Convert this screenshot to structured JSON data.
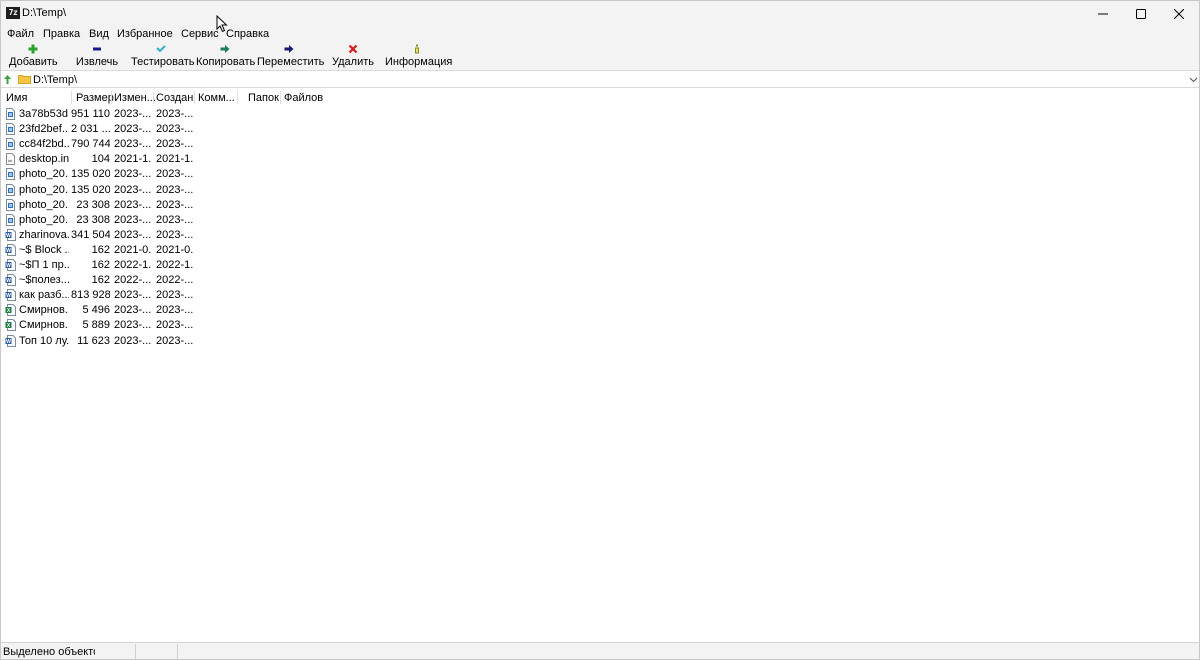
{
  "window": {
    "app_icon_text": "7z",
    "title": "D:\\Temp\\"
  },
  "menu": [
    {
      "label": "Файл"
    },
    {
      "label": "Правка"
    },
    {
      "label": "Вид"
    },
    {
      "label": "Избранное"
    },
    {
      "label": "Сервис"
    },
    {
      "label": "Справка"
    }
  ],
  "toolbar": [
    {
      "label": "Добавить",
      "icon": "plus-icon",
      "color": "#2aa12a"
    },
    {
      "label": "Извлечь",
      "icon": "minus-icon",
      "color": "#1a1a8c"
    },
    {
      "label": "Тестировать",
      "icon": "check-icon",
      "color": "#31b0c8"
    },
    {
      "label": "Копировать",
      "icon": "copy-arrow-icon",
      "color": "#1d7a63"
    },
    {
      "label": "Переместить",
      "icon": "move-arrow-icon",
      "color": "#1a1a6e"
    },
    {
      "label": "Удалить",
      "icon": "delete-x-icon",
      "color": "#d41c1c"
    },
    {
      "label": "Информация",
      "icon": "info-icon",
      "color": "#8a8a1a"
    }
  ],
  "address": {
    "path": "D:\\Temp\\"
  },
  "columns": {
    "name": "Имя",
    "size": "Размер",
    "modified": "Измен...",
    "created": "Создан",
    "comment": "Комм...",
    "folders": "Папок",
    "files": "Файлов"
  },
  "files": [
    {
      "name": "3a78b53d...",
      "size": "951 110",
      "modified": "2023-...",
      "created": "2023-...",
      "icon": "image-file-icon"
    },
    {
      "name": "23fd2bef...",
      "size": "2 031 ...",
      "modified": "2023-...",
      "created": "2023-...",
      "icon": "image-file-icon"
    },
    {
      "name": "cc84f2bd...",
      "size": "790 744",
      "modified": "2023-...",
      "created": "2023-...",
      "icon": "image-file-icon"
    },
    {
      "name": "desktop.ini",
      "size": "104",
      "modified": "2021-1...",
      "created": "2021-1...",
      "icon": "ini-file-icon"
    },
    {
      "name": "photo_20...",
      "size": "135 020",
      "modified": "2023-...",
      "created": "2023-...",
      "icon": "image-file-icon"
    },
    {
      "name": "photo_20...",
      "size": "135 020",
      "modified": "2023-...",
      "created": "2023-...",
      "icon": "image-file-icon"
    },
    {
      "name": "photo_20...",
      "size": "23 308",
      "modified": "2023-...",
      "created": "2023-...",
      "icon": "image-file-icon"
    },
    {
      "name": "photo_20...",
      "size": "23 308",
      "modified": "2023-...",
      "created": "2023-...",
      "icon": "image-file-icon"
    },
    {
      "name": "zharinova...",
      "size": "341 504",
      "modified": "2023-...",
      "created": "2023-...",
      "icon": "word-doc-icon"
    },
    {
      "name": "~$ Block ...",
      "size": "162",
      "modified": "2021-0...",
      "created": "2021-0...",
      "icon": "word-doc-icon"
    },
    {
      "name": "~$П 1 пр...",
      "size": "162",
      "modified": "2022-1...",
      "created": "2022-1...",
      "icon": "word-doc-icon"
    },
    {
      "name": "~$полез...",
      "size": "162",
      "modified": "2022-...",
      "created": "2022-...",
      "icon": "word-doc-icon"
    },
    {
      "name": "как разб...",
      "size": "813 928",
      "modified": "2023-...",
      "created": "2023-...",
      "icon": "word-doc-icon"
    },
    {
      "name": "Смирнов...",
      "size": "5 496",
      "modified": "2023-...",
      "created": "2023-...",
      "icon": "excel-file-icon"
    },
    {
      "name": "Смирнов...",
      "size": "5 889",
      "modified": "2023-...",
      "created": "2023-...",
      "icon": "excel-file-icon"
    },
    {
      "name": "Топ 10 лу...",
      "size": "11 623",
      "modified": "2023-...",
      "created": "2023-...",
      "icon": "word-doc-icon"
    }
  ],
  "status": {
    "selected_text": "Выделено объектов"
  }
}
